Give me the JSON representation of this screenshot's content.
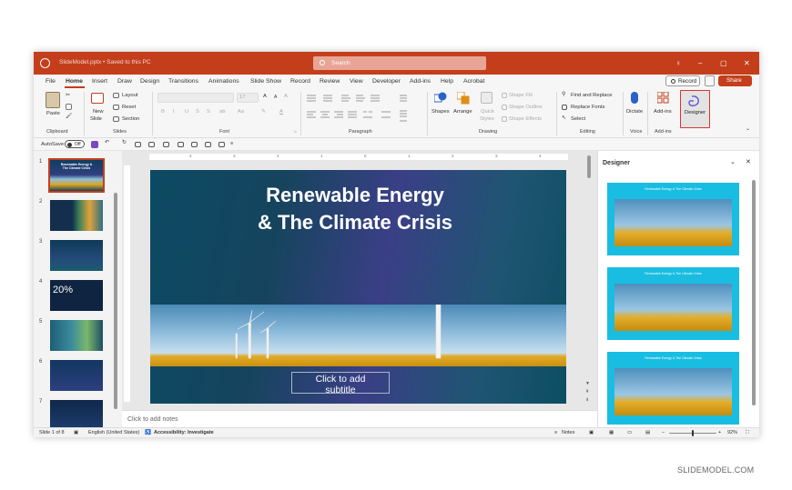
{
  "app": {
    "title": "SlideModel.pptx • Saved to this PC",
    "search_placeholder": "Search"
  },
  "menu": {
    "tabs": [
      "File",
      "Home",
      "Insert",
      "Draw",
      "Design",
      "Transitions",
      "Animations",
      "Slide Show",
      "Record",
      "Review",
      "View",
      "Developer",
      "Add-ins",
      "Help",
      "Acrobat"
    ],
    "record_label": "Record",
    "share_label": "Share"
  },
  "ribbon": {
    "clipboard": {
      "paste": "Paste",
      "group": "Clipboard"
    },
    "slides": {
      "new_slide_1": "New",
      "new_slide_2": "Slide",
      "layout": "Layout",
      "reset": "Reset",
      "section": "Section",
      "group": "Slides"
    },
    "font": {
      "size": "17",
      "group": "Font",
      "bold": "B",
      "italic": "I",
      "underline": "U",
      "strike": "S",
      "spacing": "ab",
      "case": "Aa",
      "grow": "A",
      "shrink": "A",
      "color_a": "A"
    },
    "paragraph": {
      "group": "Paragraph"
    },
    "drawing": {
      "shapes": "Shapes",
      "arrange": "Arrange",
      "quick_styles_1": "Quick",
      "quick_styles_2": "Styles",
      "shape_fill": "Shape Fill",
      "shape_outline": "Shape Outline",
      "shape_effects": "Shape Effects",
      "group": "Drawing"
    },
    "editing": {
      "find_replace": "Find and Replace",
      "replace_fonts": "Replace Fonts",
      "select": "Select",
      "group": "Editing"
    },
    "voice": {
      "dictate": "Dictate",
      "group": "Voice"
    },
    "addins": {
      "addins": "Add-ins",
      "designer": "Designer",
      "group": "Add-ins"
    }
  },
  "qat": {
    "autosave_label": "AutoSave",
    "autosave_state": "Off"
  },
  "thumbnails": [
    "1",
    "2",
    "3",
    "4",
    "5",
    "6",
    "7"
  ],
  "thumb_texts": {
    "t1": "Renewable Energy & The Climate Crisis",
    "t4": "20%"
  },
  "ruler": [
    "4",
    "3",
    "2",
    "1",
    "0",
    "1",
    "2",
    "3",
    "4"
  ],
  "slide": {
    "title_line1": "Renewable Energy",
    "title_line2": "& The Climate Crisis",
    "subtitle_line1": "Click to add",
    "subtitle_line2": "subtitle"
  },
  "notes_placeholder": "Click to add notes",
  "designer": {
    "title": "Designer",
    "card_text": "Renewable Energy & The Climate Crisis"
  },
  "status": {
    "slide": "Slide 1 of 8",
    "language": "English (United States)",
    "accessibility": "Accessibility: Investigate",
    "notes": "Notes",
    "zoom": "92%"
  },
  "watermark": "SLIDEMODEL.COM",
  "colors": {
    "accent": "#c43e1c",
    "designer_card": "#19bde2"
  }
}
